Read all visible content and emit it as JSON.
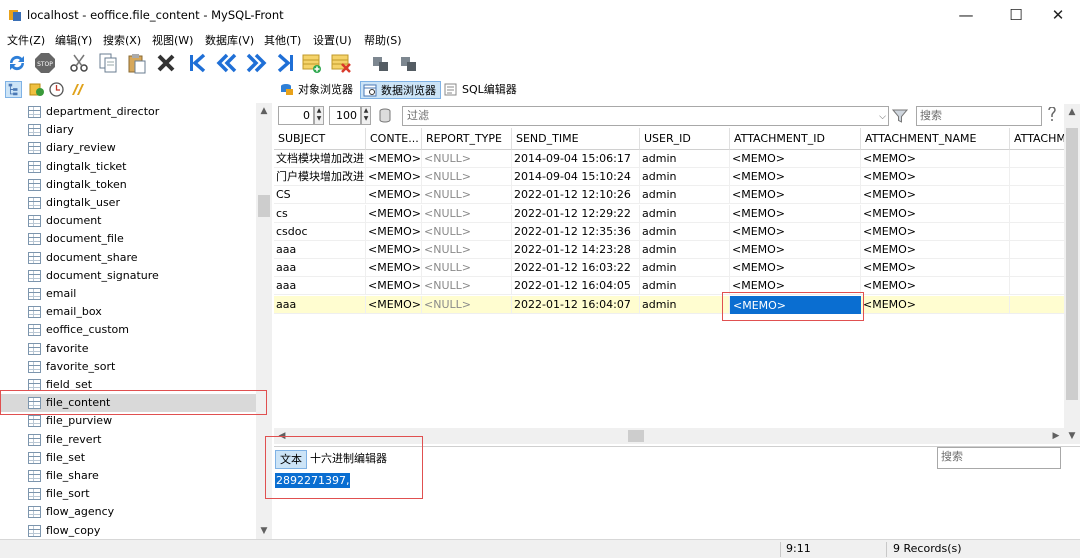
{
  "window": {
    "title": "localhost - eoffice.file_content - MySQL-Front",
    "minimize": "—",
    "maximize": "☐",
    "close": "✕"
  },
  "menu": [
    "文件(Z)",
    "编辑(Y)",
    "搜索(X)",
    "视图(W)",
    "数据库(V)",
    "其他(T)",
    "设置(U)",
    "帮助(S)"
  ],
  "toolbar_icons": [
    "refresh-icon",
    "stop-icon",
    "cut-icon",
    "copy-icon",
    "paste-icon",
    "delete-icon",
    "first-record-icon",
    "previous-record-icon",
    "next-record-icon",
    "last-record-icon",
    "insert-record-icon",
    "delete-record-icon",
    "post-icon",
    "cancel-icon"
  ],
  "tabs": [
    "对象浏览器",
    "数据浏览器",
    "SQL编辑器"
  ],
  "active_tab": "数据浏览器",
  "filter": {
    "offset": "0",
    "limit": "100",
    "filter_placeholder": "过滤",
    "search_placeholder": "搜索"
  },
  "tree": {
    "items": [
      "department_director",
      "diary",
      "diary_review",
      "dingtalk_ticket",
      "dingtalk_token",
      "dingtalk_user",
      "document",
      "document_file",
      "document_share",
      "document_signature",
      "email",
      "email_box",
      "eoffice_custom",
      "favorite",
      "favorite_sort",
      "field_set",
      "file_content",
      "file_purview",
      "file_revert",
      "file_set",
      "file_share",
      "file_sort",
      "flow_agency",
      "flow_copy"
    ],
    "selected": "file_content"
  },
  "grid": {
    "columns": [
      "SUBJECT",
      "CONTE...",
      "REPORT_TYPE",
      "SEND_TIME",
      "USER_ID",
      "ATTACHMENT_ID",
      "ATTACHMENT_NAME",
      "ATTACHM"
    ],
    "rows": [
      [
        "文档模块增加改进",
        "<MEMO>",
        "<NULL>",
        "2014-09-04 15:06:17",
        "admin",
        "<MEMO>",
        "<MEMO>",
        ""
      ],
      [
        "门户模块增加改进",
        "<MEMO>",
        "<NULL>",
        "2014-09-04 15:10:24",
        "admin",
        "<MEMO>",
        "<MEMO>",
        ""
      ],
      [
        "CS",
        "<MEMO>",
        "<NULL>",
        "2022-01-12 12:10:26",
        "admin",
        "<MEMO>",
        "<MEMO>",
        ""
      ],
      [
        "cs",
        "<MEMO>",
        "<NULL>",
        "2022-01-12 12:29:22",
        "admin",
        "<MEMO>",
        "<MEMO>",
        ""
      ],
      [
        "csdoc",
        "<MEMO>",
        "<NULL>",
        "2022-01-12 12:35:36",
        "admin",
        "<MEMO>",
        "<MEMO>",
        ""
      ],
      [
        "aaa",
        "<MEMO>",
        "<NULL>",
        "2022-01-12 14:23:28",
        "admin",
        "<MEMO>",
        "<MEMO>",
        ""
      ],
      [
        "aaa",
        "<MEMO>",
        "<NULL>",
        "2022-01-12 16:03:22",
        "admin",
        "<MEMO>",
        "<MEMO>",
        ""
      ],
      [
        "aaa",
        "<MEMO>",
        "<NULL>",
        "2022-01-12 16:04:05",
        "admin",
        "<MEMO>",
        "<MEMO>",
        ""
      ],
      [
        "aaa",
        "<MEMO>",
        "<NULL>",
        "2022-01-12 16:04:07",
        "admin",
        "<MEMO>",
        "<MEMO>",
        ""
      ]
    ],
    "selected_row": 8,
    "focused_column": 5
  },
  "memo_editor": {
    "tabs": [
      "文本",
      "十六进制编辑器"
    ],
    "active_tab": "文本",
    "search_placeholder": "搜索",
    "content": "2892271397,"
  },
  "status": {
    "position": "9:11",
    "records": "9 Records(s)"
  },
  "colors": {
    "selection": "#0a6ed1",
    "highlight_row": "#fffdd0",
    "annotation": "#e05050",
    "tab_active": "#cce4f7"
  }
}
